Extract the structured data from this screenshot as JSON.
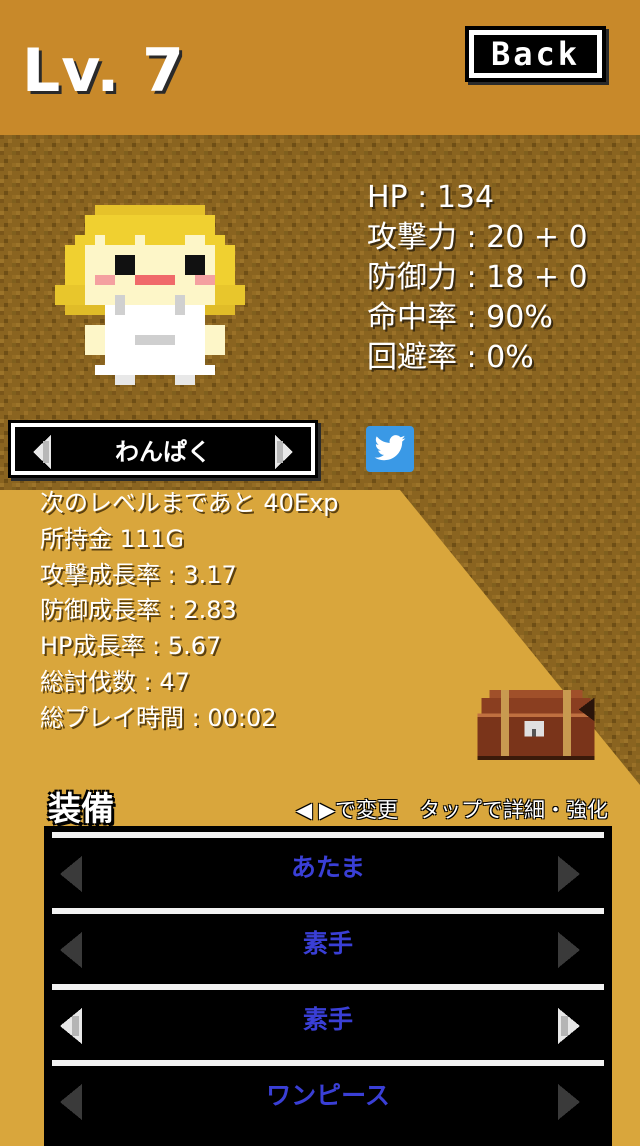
{
  "header": {
    "level": "Lv. 7",
    "back_label": "Back"
  },
  "stats": [
    "HP : 134",
    "攻撃力 : 20 + 0",
    "防御力 : 18 + 0",
    "命中率 : 90%",
    "回避率 : 0%"
  ],
  "personality": {
    "label": "わんぱく"
  },
  "info": [
    "次のレベルまであと 40Exp",
    "所持金 111G",
    "攻撃成長率 : 3.17",
    "防御成長率 : 2.83",
    "HP成長率 : 5.67",
    "総討伐数 : 47",
    "総プレイ時間 : 00:02"
  ],
  "equipment": {
    "title": "装備",
    "hint": "◀ ▶で変更　タップで詳細・強化",
    "slots": [
      {
        "label": "あたま",
        "arrows_active": false
      },
      {
        "label": "素手",
        "arrows_active": false
      },
      {
        "label": "素手",
        "arrows_active": true
      },
      {
        "label": "ワンピース",
        "arrows_active": false
      }
    ]
  },
  "colors": {
    "header_bg": "#c8892a",
    "brown_texture": "#8a6420",
    "gold_bg": "#d9a63c",
    "equip_label": "#3a3fd6",
    "twitter_blue": "#3a99e6"
  },
  "icons": [
    "twitter-icon",
    "treasure-chest-icon",
    "arrow-left-icon",
    "arrow-right-icon"
  ]
}
